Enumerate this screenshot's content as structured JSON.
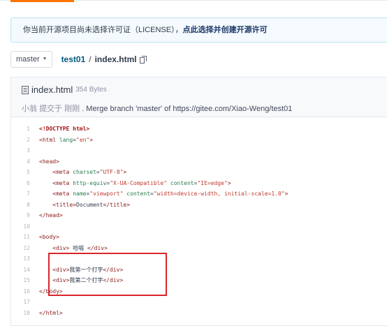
{
  "notice": {
    "text": "你当前开源项目尚未选择许可证（LICENSE），",
    "link": "点此选择并创建开源许可"
  },
  "branch": {
    "label": "master"
  },
  "breadcrumb": {
    "repo": "test01",
    "separator": "/",
    "file": "index.html"
  },
  "file": {
    "name": "index.html",
    "size": "354 Bytes",
    "commit_author": "小翁",
    "commit_action": "提交于",
    "commit_time": "刚刚",
    "commit_message": ". Merge branch 'master' of https://gitee.com/Xiao-Weng/test01"
  },
  "code_lines": [
    {
      "n": "1",
      "text": "<!DOCTYPE html>"
    },
    {
      "n": "2",
      "text": "<html lang=\"en\">"
    },
    {
      "n": "3",
      "text": ""
    },
    {
      "n": "4",
      "text": "<head>"
    },
    {
      "n": "5",
      "text": "    <meta charset=\"UTF-8\">"
    },
    {
      "n": "6",
      "text": "    <meta http-equiv=\"X-UA-Compatible\" content=\"IE=edge\">"
    },
    {
      "n": "7",
      "text": "    <meta name=\"viewport\" content=\"width=device-width, initial-scale=1.0\">"
    },
    {
      "n": "8",
      "text": "    <title>Document</title>"
    },
    {
      "n": "9",
      "text": "</head>"
    },
    {
      "n": "10",
      "text": ""
    },
    {
      "n": "11",
      "text": "<body>"
    },
    {
      "n": "12",
      "text": "    <div> 哈喵 </div>"
    },
    {
      "n": "13",
      "text": ""
    },
    {
      "n": "14",
      "text": "    <div>我第一个打字</div>"
    },
    {
      "n": "15",
      "text": "    <div>我第二个打字</div>"
    },
    {
      "n": "16",
      "text": "</body>"
    },
    {
      "n": "17",
      "text": ""
    },
    {
      "n": "18",
      "text": "</html>"
    }
  ],
  "colors": {
    "accent": "#fe7300",
    "annotation": "#d9262c",
    "repo_link": "#005980"
  }
}
